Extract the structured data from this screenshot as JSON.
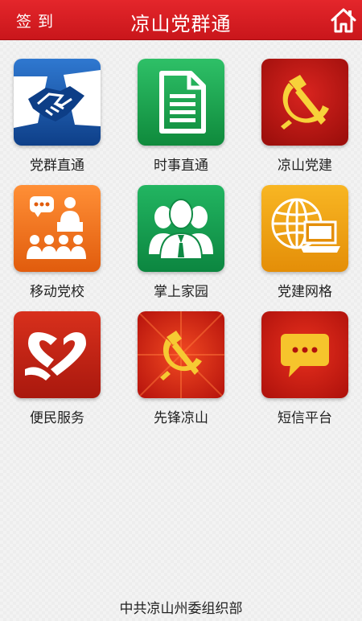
{
  "header": {
    "checkin_label": "签到",
    "title": "凉山党群通",
    "home_icon": "home-icon"
  },
  "tiles": [
    {
      "label": "党群直通",
      "icon": "handshake-icon"
    },
    {
      "label": "时事直通",
      "icon": "document-icon"
    },
    {
      "label": "凉山党建",
      "icon": "hammer-sickle-icon"
    },
    {
      "label": "移动党校",
      "icon": "classroom-icon"
    },
    {
      "label": "掌上家园",
      "icon": "people-group-icon"
    },
    {
      "label": "党建网格",
      "icon": "globe-laptop-icon"
    },
    {
      "label": "便民服务",
      "icon": "heart-logo-icon"
    },
    {
      "label": "先锋凉山",
      "icon": "party-emblem-icon"
    },
    {
      "label": "短信平台",
      "icon": "message-bubble-icon"
    }
  ],
  "footer": {
    "text": "中共凉山州委组织部"
  },
  "colors": {
    "header": "#d81e23",
    "tile_blue": "#1f5aa8",
    "tile_green": "#1aa24e",
    "tile_red": "#c41a18",
    "tile_orange": "#f07a1e",
    "tile_yellow": "#f3a414"
  }
}
